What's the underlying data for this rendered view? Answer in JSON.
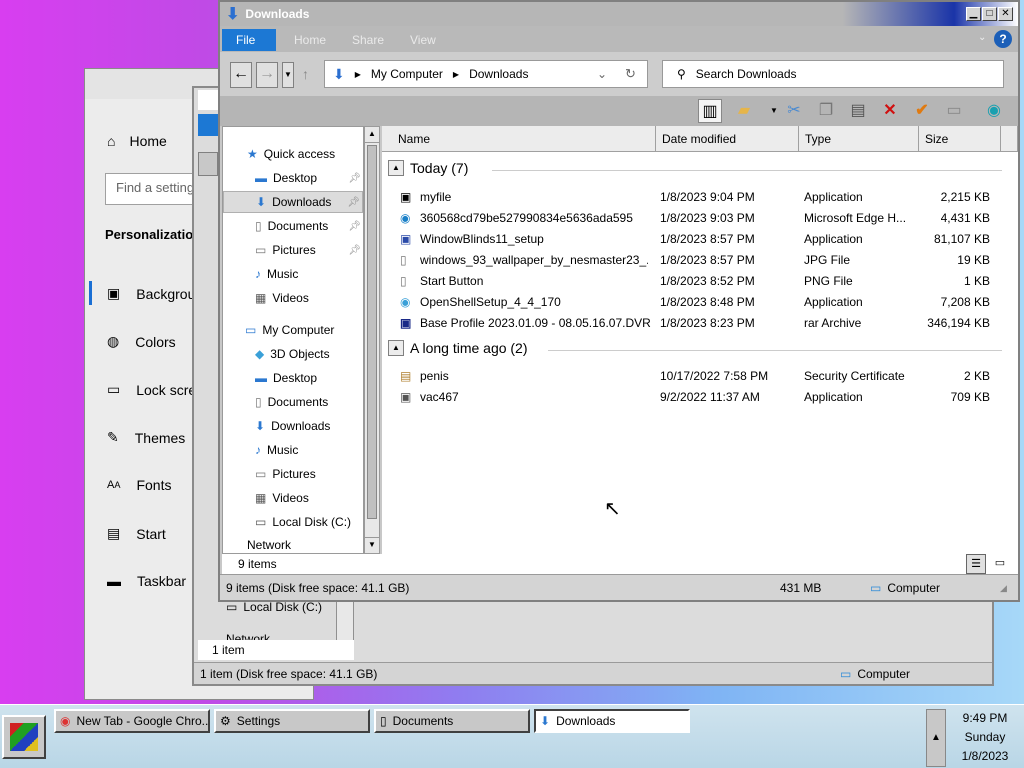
{
  "settings": {
    "home": "Home",
    "search_placeholder": "Find a setting",
    "section": "Personalization",
    "items": [
      "Background",
      "Colors",
      "Lock screen",
      "Themes",
      "Fonts",
      "Start",
      "Taskbar"
    ]
  },
  "documents_window": {
    "nav_local_disk": "Local Disk (C:)",
    "nav_network": "Network",
    "items_count": "1 item",
    "status": "1 item (Disk free space: 41.1 GB)",
    "status_right": "Computer"
  },
  "downloads_window": {
    "title": "Downloads",
    "ribbon_tabs": [
      "File",
      "Home",
      "Share",
      "View"
    ],
    "address": {
      "root": "My Computer",
      "folder": "Downloads"
    },
    "search_placeholder": "Search Downloads",
    "nav": {
      "quick_access": "Quick access",
      "quick": [
        "Desktop",
        "Downloads",
        "Documents",
        "Pictures",
        "Music",
        "Videos"
      ],
      "my_computer": "My Computer",
      "computer": [
        "3D Objects",
        "Desktop",
        "Documents",
        "Downloads",
        "Music",
        "Pictures",
        "Videos",
        "Local Disk (C:)"
      ],
      "network": "Network"
    },
    "columns": [
      "Name",
      "Date modified",
      "Type",
      "Size"
    ],
    "groups": [
      {
        "label": "Today (7)",
        "rows": [
          {
            "name": "myfile",
            "date": "1/8/2023 9:04 PM",
            "type": "Application",
            "size": "2,215 KB"
          },
          {
            "name": "360568cd79be527990834e5636ada595",
            "date": "1/8/2023 9:03 PM",
            "type": "Microsoft Edge H...",
            "size": "4,431 KB"
          },
          {
            "name": "WindowBlinds11_setup",
            "date": "1/8/2023 8:57 PM",
            "type": "Application",
            "size": "81,107 KB"
          },
          {
            "name": "windows_93_wallpaper_by_nesmaster23_...",
            "date": "1/8/2023 8:57 PM",
            "type": "JPG File",
            "size": "19 KB"
          },
          {
            "name": "Start Button",
            "date": "1/8/2023 8:52 PM",
            "type": "PNG File",
            "size": "1 KB"
          },
          {
            "name": "OpenShellSetup_4_4_170",
            "date": "1/8/2023 8:48 PM",
            "type": "Application",
            "size": "7,208 KB"
          },
          {
            "name": "Base Profile 2023.01.09 - 08.05.16.07.DVR",
            "date": "1/8/2023 8:23 PM",
            "type": "rar Archive",
            "size": "346,194 KB"
          }
        ]
      },
      {
        "label": "A long time ago (2)",
        "rows": [
          {
            "name": "penis",
            "date": "10/17/2022 7:58 PM",
            "type": "Security Certificate",
            "size": "2 KB"
          },
          {
            "name": "vac467",
            "date": "9/2/2022 11:37 AM",
            "type": "Application",
            "size": "709 KB"
          }
        ]
      }
    ],
    "items_count": "9 items",
    "status": "9 items (Disk free space: 41.1 GB)",
    "status_size": "431 MB",
    "status_right": "Computer"
  },
  "taskbar": {
    "tasks": [
      "New Tab - Google Chro...",
      "Settings",
      "Documents",
      "Downloads"
    ],
    "time": "9:49 PM",
    "day": "Sunday",
    "date": "1/8/2023"
  },
  "colors": {
    "accent": "#1c78d4",
    "titlebar_gradient_end": "#1a34a8"
  }
}
